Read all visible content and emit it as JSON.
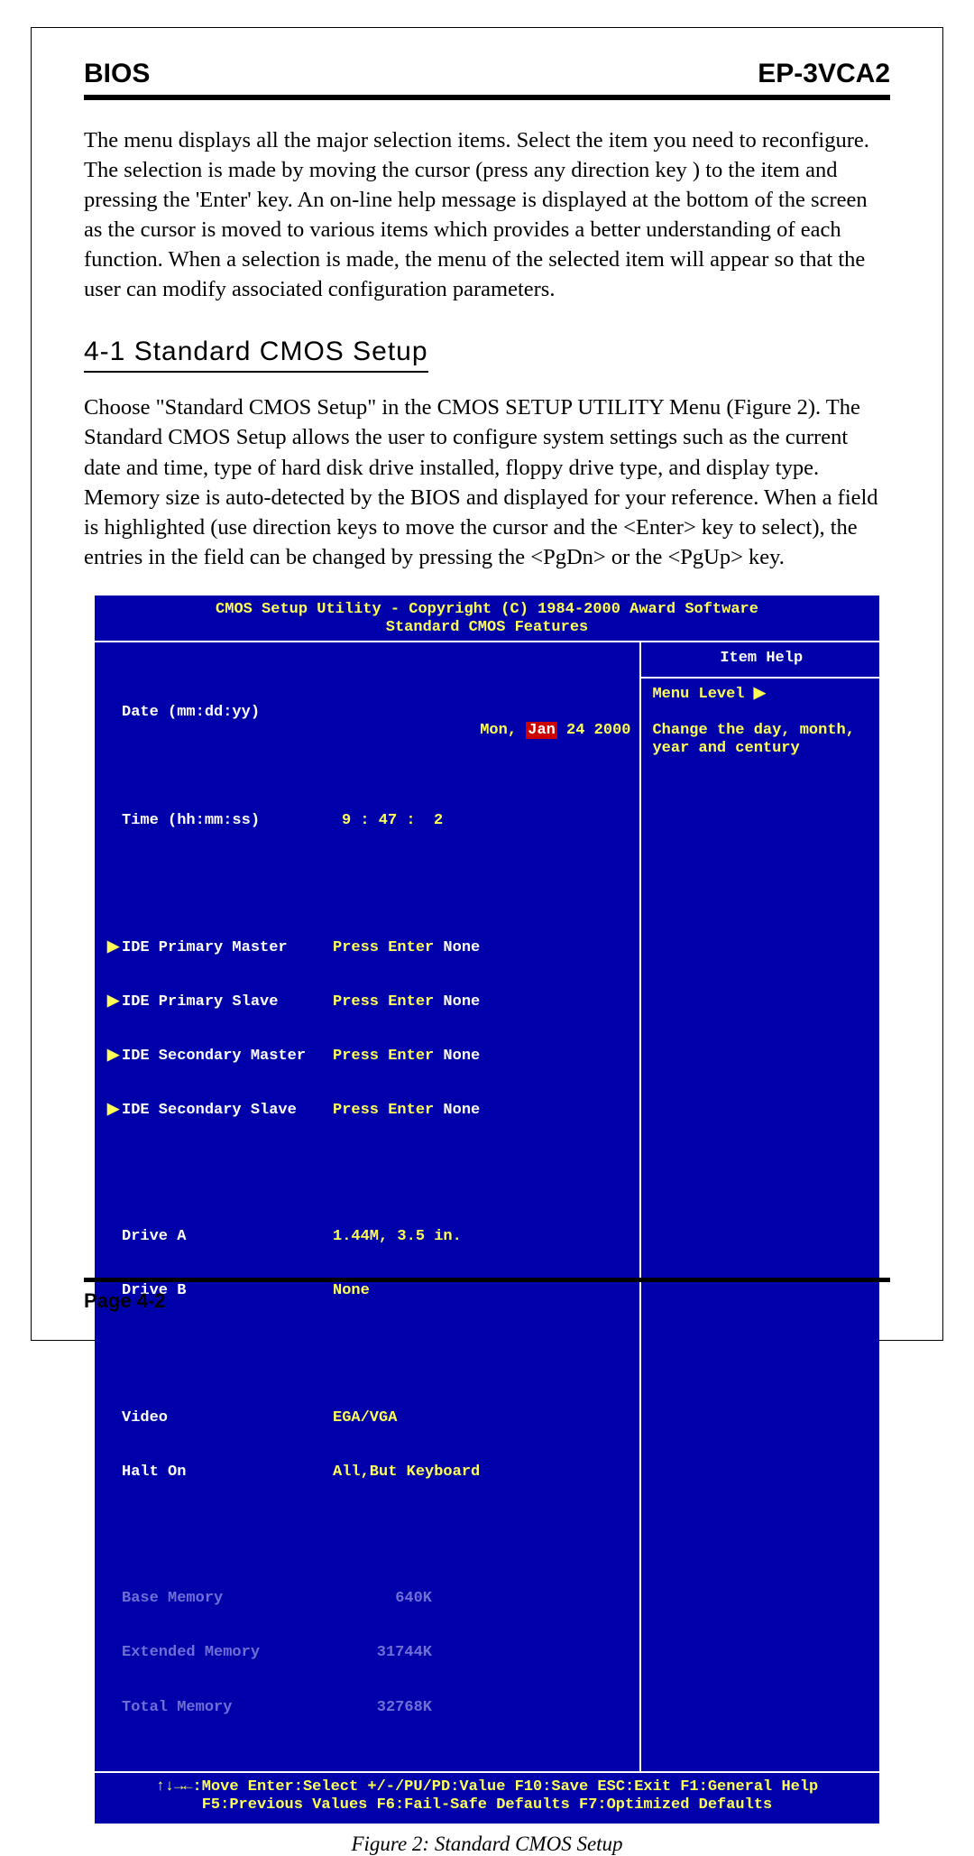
{
  "header": {
    "left": "BIOS",
    "right": "EP-3VCA2"
  },
  "intro_paragraph": "The menu displays all the major selection items. Select the item you need to reconfigure. The selection is made by moving the cursor (press any direction key ) to the item and pressing the 'Enter' key. An on-line help message is displayed at the bottom of the screen as the cursor is moved to various items which provides a better understanding of each function. When a selection is made, the menu of the selected item will appear so that the user can modify associated configuration parameters.",
  "section_heading": "4-1 Standard CMOS Setup",
  "section_paragraph": "Choose \"Standard CMOS Setup\" in the CMOS SETUP UTILITY Menu (Figure 2). The  Standard CMOS Setup allows the user to configure system settings such as the current date and time, type of hard disk drive installed, floppy drive type, and display type. Memory size is auto-detected by the BIOS and displayed for your reference. When a field is highlighted (use direction keys to move the cursor and the <Enter> key to select), the entries in the field can be changed by pressing the <PgDn> or the <PgUp> key.",
  "bios": {
    "title_line1": "CMOS Setup Utility - Copyright (C) 1984-2000 Award Software",
    "title_line2": "Standard CMOS Features",
    "date_label": "Date (mm:dd:yy)",
    "date_prefix": "Mon, ",
    "date_highlight": "Jan",
    "date_suffix": " 24 2000",
    "time_label": "Time (hh:mm:ss)",
    "time_value": "9 : 47 :  2",
    "ide_rows": [
      {
        "label": "IDE Primary Master",
        "action": "Press Enter",
        "value": "None"
      },
      {
        "label": "IDE Primary Slave",
        "action": "Press Enter",
        "value": "None"
      },
      {
        "label": "IDE Secondary Master",
        "action": "Press Enter",
        "value": "None"
      },
      {
        "label": "IDE Secondary Slave",
        "action": "Press Enter",
        "value": "None"
      }
    ],
    "drive_a_label": "Drive A",
    "drive_a_value": "1.44M, 3.5 in.",
    "drive_b_label": "Drive B",
    "drive_b_value": "None",
    "video_label": "Video",
    "video_value": "EGA/VGA",
    "halt_label": "Halt On",
    "halt_value": "All,But Keyboard",
    "mem_rows": [
      {
        "label": "Base Memory",
        "value": "640K"
      },
      {
        "label": "Extended Memory",
        "value": "31744K"
      },
      {
        "label": "Total Memory",
        "value": "32768K"
      }
    ],
    "help_title": "Item Help",
    "help_menu_level": "Menu Level   ",
    "help_body_line1": "Change the day, month,",
    "help_body_line2": "year and century",
    "footer_line1": "↑↓→←:Move  Enter:Select  +/-/PU/PD:Value  F10:Save  ESC:Exit  F1:General Help",
    "footer_line2": "F5:Previous Values    F6:Fail-Safe Defaults    F7:Optimized Defaults"
  },
  "figure_caption": "Figure 2:  Standard CMOS Setup",
  "page_number": "Page 4-2"
}
